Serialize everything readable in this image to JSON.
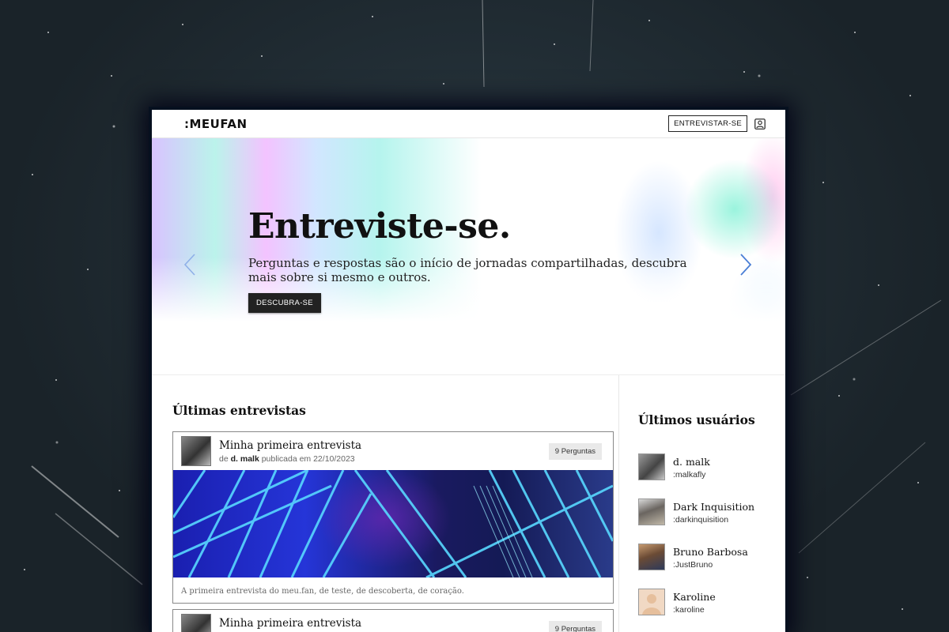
{
  "header": {
    "logo": ":MEUFAN",
    "interview_button": "ENTREVISTAR-SE",
    "user_icon": "user-icon"
  },
  "hero": {
    "title": "Entreviste-se.",
    "text": "Perguntas e respostas são o início de jornadas compartilhadas, descubra mais sobre si mesmo e outros.",
    "button": "DESCUBRA-SE",
    "prev_icon": "chevron-left-icon",
    "next_icon": "chevron-right-icon",
    "arrow_color": "#4a7fd6"
  },
  "interviews": {
    "title": "Últimas entrevistas",
    "items": [
      {
        "title": "Minha primeira entrevista",
        "by_prefix": "de",
        "author": "d. malk",
        "published": "publicada em 22/10/2023",
        "questions": "9 Perguntas",
        "description": "A primeira entrevista do meu.fan, de teste, de descoberta, de coração."
      },
      {
        "title": "Minha primeira entrevista",
        "questions": "9 Perguntas"
      }
    ]
  },
  "users": {
    "title": "Últimos usuários",
    "items": [
      {
        "name": "d. malk",
        "handle": ":malkafly",
        "avatar_color": "#6a6a6a"
      },
      {
        "name": "Dark Inquisition",
        "handle": ":darkinquisition",
        "avatar_color": "#5a5550"
      },
      {
        "name": "Bruno Barbosa",
        "handle": ":JustBruno",
        "avatar_color": "#7a5a40"
      },
      {
        "name": "Karoline",
        "handle": ":karoline",
        "avatar_color": "#f1d9c4"
      }
    ]
  }
}
